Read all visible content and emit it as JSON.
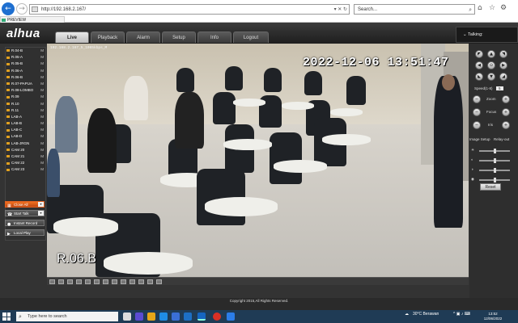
{
  "browser": {
    "url": "http://192.168.2.167/",
    "search_placeholder": "Search...",
    "tab_label": "PREVIEW"
  },
  "app": {
    "logo": "alhua",
    "nav_tabs": [
      "Live",
      "Playback",
      "Alarm",
      "Setup",
      "Info",
      "Logout"
    ],
    "active_tab": "Live",
    "talking_label": "Talking:"
  },
  "channels": [
    {
      "name": "R.04-B",
      "mark": "M"
    },
    {
      "name": "R.05-A",
      "mark": "M"
    },
    {
      "name": "R.05-B",
      "mark": "M"
    },
    {
      "name": "R.06-A",
      "mark": "M"
    },
    {
      "name": "R.06-B",
      "mark": "M"
    },
    {
      "name": "R.07-PAPUA",
      "mark": "M"
    },
    {
      "name": "R.08-LOMBO",
      "mark": "M"
    },
    {
      "name": "R.09",
      "mark": "M"
    },
    {
      "name": "R.10",
      "mark": "M"
    },
    {
      "name": "R.11",
      "mark": "M"
    },
    {
      "name": "LAB-A",
      "mark": "M"
    },
    {
      "name": "LAB-B",
      "mark": "M"
    },
    {
      "name": "LAB-C",
      "mark": "M"
    },
    {
      "name": "LAB-D",
      "mark": "M"
    },
    {
      "name": "LAB-JRGN",
      "mark": "M"
    },
    {
      "name": "CAM 20",
      "mark": "M"
    },
    {
      "name": "CAM 21",
      "mark": "M"
    },
    {
      "name": "CAM 22",
      "mark": "M"
    },
    {
      "name": "CAM 23",
      "mark": "M"
    }
  ],
  "left_buttons": {
    "close_all": "Close All",
    "start_talk": "Start Talk",
    "instant_record": "Instant Record",
    "local_play": "Local Play"
  },
  "video": {
    "osd_url": "192.168.2.167_5_1065kbps_M",
    "timestamp": "2022-12-06  13:51:47",
    "camera_name": "R.06.B"
  },
  "ptz": {
    "speed_label": "Speed(1-8)",
    "speed_value": "5",
    "zoom_label": "Zoom",
    "focus_label": "Focus",
    "iris_label": "Iris",
    "image_setup": "Image Setup",
    "relay_out": "Relay-out",
    "reset": "Reset"
  },
  "footer": {
    "copyright": "Copyright 2015,All Rights Reserved."
  },
  "taskbar": {
    "search_text": "Type here to search",
    "weather": "30°C  Berawan",
    "time": "13:52",
    "date": "12/06/2022"
  }
}
